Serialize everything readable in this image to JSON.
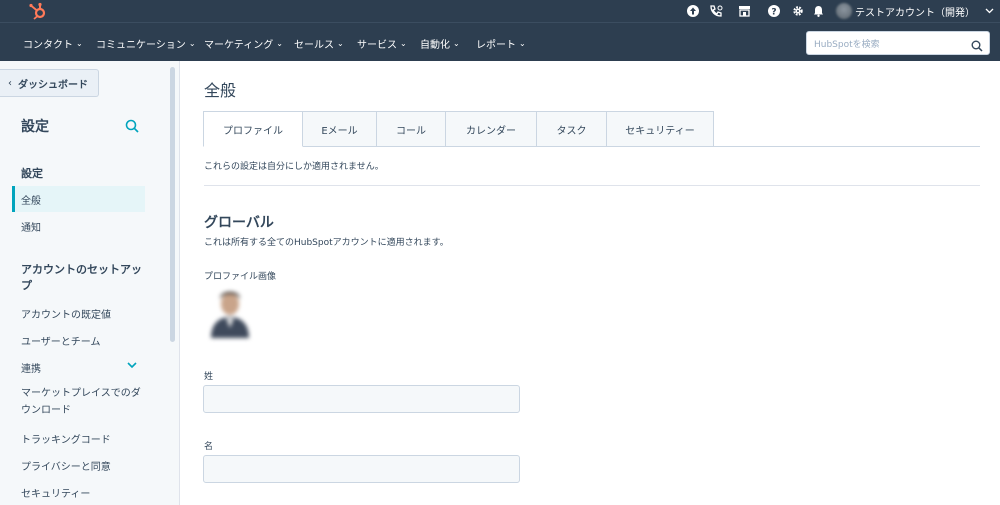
{
  "account": {
    "name": "テストアカウント（開発）"
  },
  "nav": {
    "items": [
      "コンタクト",
      "コミュニケーション",
      "マーケティング",
      "セールス",
      "サービス",
      "自動化",
      "レポート"
    ],
    "search_placeholder": "HubSpotを検索"
  },
  "sidebar": {
    "back_label": "ダッシュボード",
    "title": "設定",
    "section1": "設定",
    "item_general": "全般",
    "item_notifications": "通知",
    "section2": "アカウントのセットアップ",
    "item_defaults": "アカウントの既定値",
    "item_users": "ユーザーとチーム",
    "item_integrations": "連携",
    "item_marketplace": "マーケットプレイスでのダウンロード",
    "item_tracking": "トラッキングコード",
    "item_privacy": "プライバシーと同意",
    "item_security": "セキュリティー"
  },
  "main": {
    "title": "全般",
    "tabs": [
      "プロファイル",
      "Eメール",
      "コール",
      "カレンダー",
      "タスク",
      "セキュリティー"
    ],
    "note": "これらの設定は自分にしか適用されません。",
    "global_heading": "グローバル",
    "global_sub": "これは所有する全てのHubSpotアカウントに適用されます。",
    "photo_label": "プロファイル画像",
    "last_name_label": "姓",
    "last_name_value": "",
    "first_name_label": "名",
    "first_name_value": ""
  },
  "colors": {
    "nav_bg": "#2d3e50",
    "accent": "#00a4bd",
    "hubspot_orange": "#ff7a59"
  }
}
